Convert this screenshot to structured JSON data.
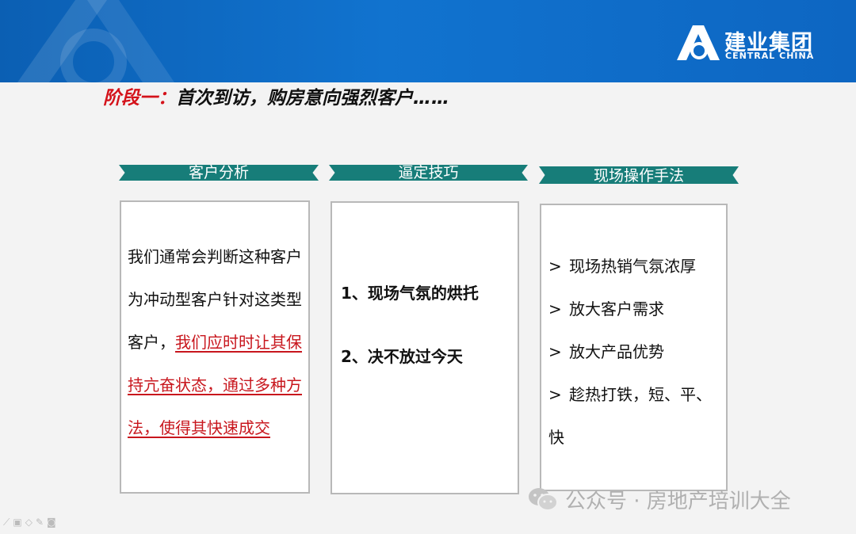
{
  "brand": {
    "name_cn": "建业集团",
    "name_en": "CENTRAL CHINA",
    "logo_icon": "central-china-logo-icon",
    "header_color": "#0d66c2"
  },
  "title": {
    "stage": "阶段一：",
    "text": "首次到访，购房意向强烈客户……",
    "stage_color": "#d4121a"
  },
  "columns": [
    {
      "banner": "客户分析",
      "lines": [
        {
          "text": "我们通常会判断这种客户为冲动型客户针对这类型客户，"
        },
        {
          "text": "我们应时时让其保持亢奋状态，通过多种方法，使得其快速成交",
          "highlight": true
        }
      ]
    },
    {
      "banner": "逼定技巧",
      "items": [
        "1、现场气氛的烘托",
        "2、决不放过今天"
      ]
    },
    {
      "banner": "现场操作手法",
      "items": [
        "现场热销气氛浓厚",
        "放大客户需求",
        "放大产品优势",
        "趁热打铁，短、平、快"
      ],
      "bullet": ">"
    }
  ],
  "banner_color": "#177d79",
  "watermark": {
    "icon": "wechat-icon",
    "text": "公众号 · 房地产培训大全"
  },
  "toolbar": {
    "icons": [
      "pointer-icon",
      "pen-icon",
      "eraser-icon",
      "highlighter-icon",
      "camera-icon"
    ],
    "glyphs": [
      "⟋",
      "▣",
      "◇",
      "✎",
      "◙"
    ]
  }
}
